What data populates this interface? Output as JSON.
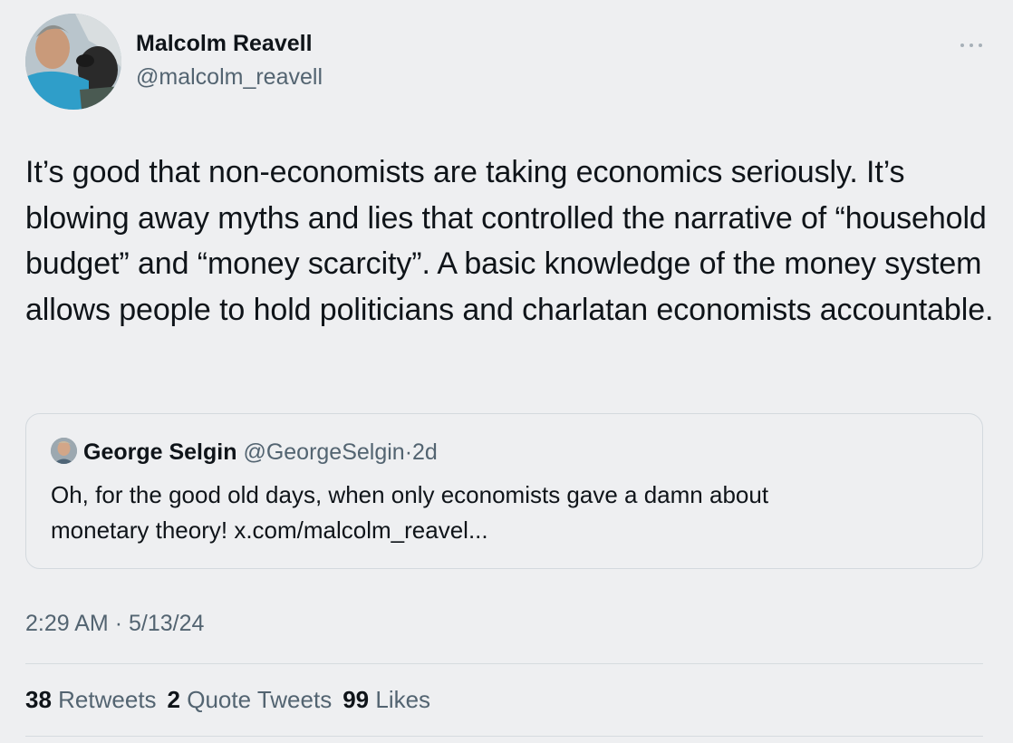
{
  "author": {
    "name": "Malcolm Reavell",
    "handle": "@malcolm_reavell"
  },
  "tweet": {
    "text": "It’s good that non-economists are taking economics seriously. It’s blowing away myths and lies that controlled the narrative of “household budget” and “money scarcity”. A basic knowledge of the money system allows people to hold politicians and charlatan economists accountable.",
    "time": "2:29 AM",
    "separator": "·",
    "date": "5/13/24"
  },
  "quote": {
    "name": "George Selgin",
    "handle": "@GeorgeSelgin",
    "separator": "·",
    "age": "2d",
    "text_line1": "Oh, for the good old days, when only economists gave a damn about",
    "text_line2": "monetary theory! x.com/malcolm_reavel..."
  },
  "stats": {
    "retweets_count": "38",
    "retweets_label": "Retweets",
    "quotes_count": "2",
    "quotes_label": "Quote Tweets",
    "likes_count": "99",
    "likes_label": "Likes"
  },
  "icons": {
    "more": "more-horizontal-icon"
  },
  "colors": {
    "background": "#eeeff1",
    "primary_text": "#0f1419",
    "secondary_text": "#536471",
    "border": "#d3d9de"
  }
}
